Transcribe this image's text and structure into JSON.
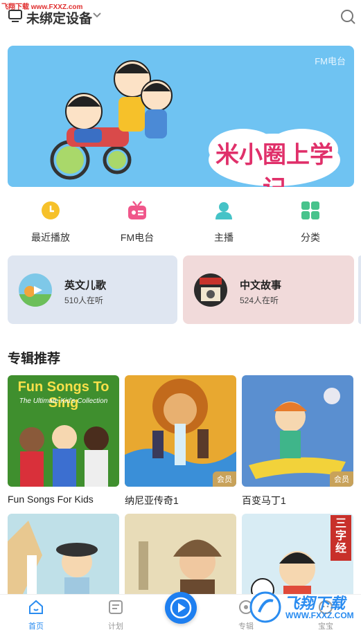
{
  "watermark": {
    "top": "飞翔下载 www.FXXZ.com",
    "bottom_cn": "飞翔下载",
    "bottom_url": "WWW.FXXZ.COM"
  },
  "header": {
    "title": "未绑定设备"
  },
  "banner": {
    "tag": "FM电台",
    "title": "米小圈上学记",
    "dots_total": 2,
    "dots_active": 1
  },
  "quick_nav": [
    {
      "label": "最近播放",
      "icon": "clock-icon",
      "color": "#f6c12a"
    },
    {
      "label": "FM电台",
      "icon": "radio-icon",
      "color": "#f0568a"
    },
    {
      "label": "主播",
      "icon": "person-icon",
      "color": "#45c3c7"
    },
    {
      "label": "分类",
      "icon": "grid-icon",
      "color": "#48c38c"
    }
  ],
  "category_cards": [
    {
      "title": "英文儿歌",
      "subtitle": "510人在听",
      "bg": "#dfe6f1"
    },
    {
      "title": "中文故事",
      "subtitle": "524人在听",
      "bg": "#f1dada"
    }
  ],
  "section": {
    "title": "专辑推荐"
  },
  "albums": [
    {
      "name": "Fun Songs For Kids",
      "cover_text": "Fun Songs To Sing",
      "cover_sub": "The Ultimate Kid's Collection",
      "vip": ""
    },
    {
      "name": "纳尼亚传奇1",
      "vip": "会员"
    },
    {
      "name": "百变马丁1",
      "vip": "会员"
    },
    {
      "name": "",
      "vip": ""
    },
    {
      "name": "",
      "vip": ""
    },
    {
      "name": "",
      "cover_text": "三字经",
      "vip": ""
    }
  ],
  "tabbar": {
    "tabs": [
      {
        "label": "首页",
        "icon": "home-icon",
        "active": true
      },
      {
        "label": "计划",
        "icon": "plan-icon",
        "active": false
      },
      {
        "label": "专辑",
        "icon": "album-icon",
        "active": false
      },
      {
        "label": "宝宝",
        "icon": "baby-icon",
        "active": false
      }
    ]
  },
  "colors": {
    "accent": "#2a8cf0",
    "banner_bg": "#6fc3f2",
    "vip": "#c8a25a"
  }
}
